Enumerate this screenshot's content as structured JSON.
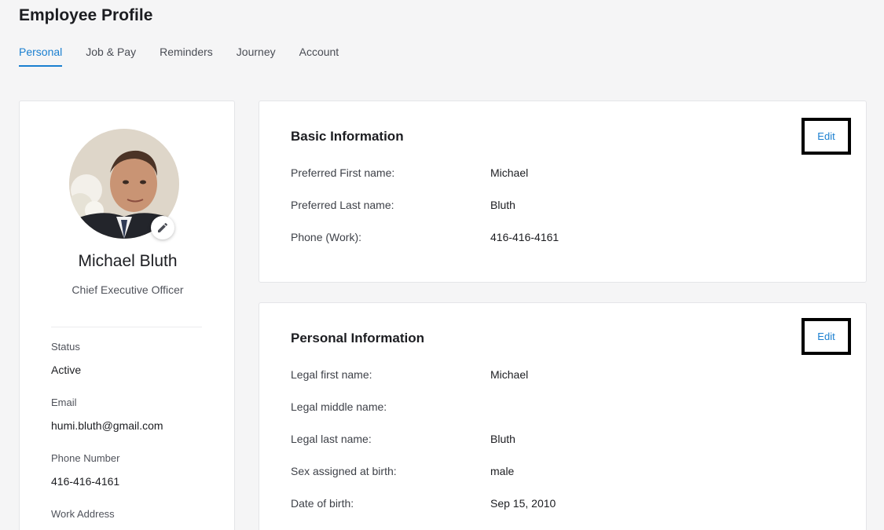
{
  "header": {
    "title": "Employee Profile"
  },
  "tabs": [
    {
      "label": "Personal"
    },
    {
      "label": "Job & Pay"
    },
    {
      "label": "Reminders"
    },
    {
      "label": "Journey"
    },
    {
      "label": "Account"
    }
  ],
  "profile": {
    "name": "Michael Bluth",
    "job_title": "Chief Executive Officer",
    "fields": [
      {
        "label": "Status",
        "value": "Active"
      },
      {
        "label": "Email",
        "value": "humi.bluth@gmail.com"
      },
      {
        "label": "Phone Number",
        "value": "416-416-4161"
      },
      {
        "label": "Work Address",
        "value": ""
      }
    ]
  },
  "basic_info": {
    "title": "Basic Information",
    "edit_label": "Edit",
    "rows": [
      {
        "label": "Preferred First name:",
        "value": "Michael"
      },
      {
        "label": "Preferred Last name:",
        "value": "Bluth"
      },
      {
        "label": "Phone (Work):",
        "value": "416-416-4161"
      }
    ]
  },
  "personal_info": {
    "title": "Personal Information",
    "edit_label": "Edit",
    "rows": [
      {
        "label": "Legal first name:",
        "value": "Michael"
      },
      {
        "label": "Legal middle name:",
        "value": ""
      },
      {
        "label": "Legal last name:",
        "value": "Bluth"
      },
      {
        "label": "Sex assigned at birth:",
        "value": "male"
      },
      {
        "label": "Date of birth:",
        "value": "Sep 15, 2010"
      }
    ]
  },
  "colors": {
    "accent": "#1a7fd0",
    "background": "#f5f5f6"
  }
}
